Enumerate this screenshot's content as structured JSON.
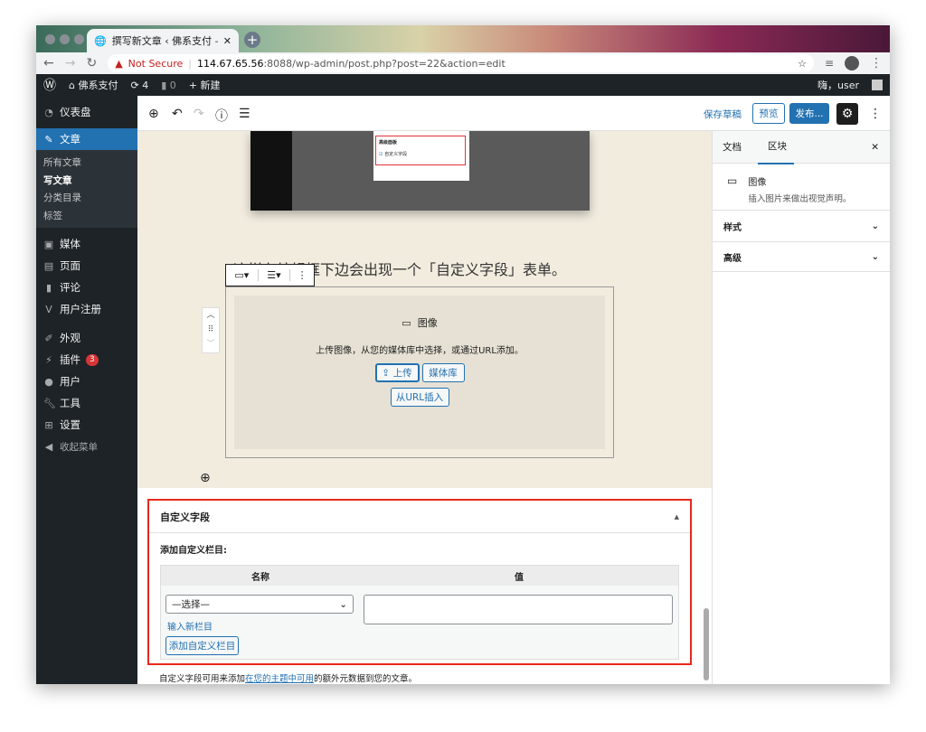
{
  "browser": {
    "tab_title": "撰写新文章 ‹ 佛系支付 — WordPress",
    "not_secure": "Not Secure",
    "url_host": "114.67.65.56",
    "url_rest": ":8088/wp-admin/post.php?post=22&action=edit"
  },
  "adminbar": {
    "site": "佛系支付",
    "updates": "4",
    "comments": "0",
    "new": "新建",
    "greeting": "嗨，user"
  },
  "sidebar": {
    "items": [
      {
        "label": "仪表盘",
        "icon": "dashboard-icon"
      },
      {
        "label": "文章",
        "icon": "pin-icon"
      },
      {
        "label": "媒体",
        "icon": "media-icon"
      },
      {
        "label": "页面",
        "icon": "page-icon"
      },
      {
        "label": "评论",
        "icon": "comment-icon"
      },
      {
        "label": "用户注册",
        "icon": "form-icon"
      },
      {
        "label": "外观",
        "icon": "brush-icon"
      },
      {
        "label": "插件",
        "icon": "plugin-icon",
        "badge": "3"
      },
      {
        "label": "用户",
        "icon": "user-icon"
      },
      {
        "label": "工具",
        "icon": "wrench-icon"
      },
      {
        "label": "设置",
        "icon": "settings-icon"
      },
      {
        "label": "收起菜单",
        "icon": "collapse-icon"
      }
    ],
    "sub": [
      "所有文章",
      "写文章",
      "分类目录",
      "标签"
    ]
  },
  "toolbar": {
    "save_draft": "保存草稿",
    "preview": "预览",
    "publish": "发布..."
  },
  "content": {
    "paragraph": "这样在编辑框下边会出现一个「自定义字段」表单。",
    "screenshot_heading": "高级面板",
    "screenshot_option": "自定义字段",
    "image_block": {
      "title": "图像",
      "instructions": "上传图像，从您的媒体库中选择，或通过URL添加。",
      "upload": "上传",
      "media_library": "媒体库",
      "insert_url": "从URL插入"
    }
  },
  "panel": {
    "tab_doc": "文档",
    "tab_block": "区块",
    "block_name": "图像",
    "block_desc": "插入图片来做出视觉声明。",
    "sections": [
      "样式",
      "高级"
    ]
  },
  "custom_fields": {
    "title": "自定义字段",
    "add_label": "添加自定义栏目:",
    "col_name": "名称",
    "col_value": "值",
    "select_value": "—选择—",
    "enter_new": "输入新栏目",
    "add_button": "添加自定义栏目",
    "help_pre": "自定义字段可用来添加",
    "help_link": "在您的主题中可用",
    "help_post": "的额外元数据到您的文章。"
  },
  "colors": {
    "accent": "#2271b1",
    "highlight": "#e8291c",
    "admin_dark": "#1d2327"
  }
}
